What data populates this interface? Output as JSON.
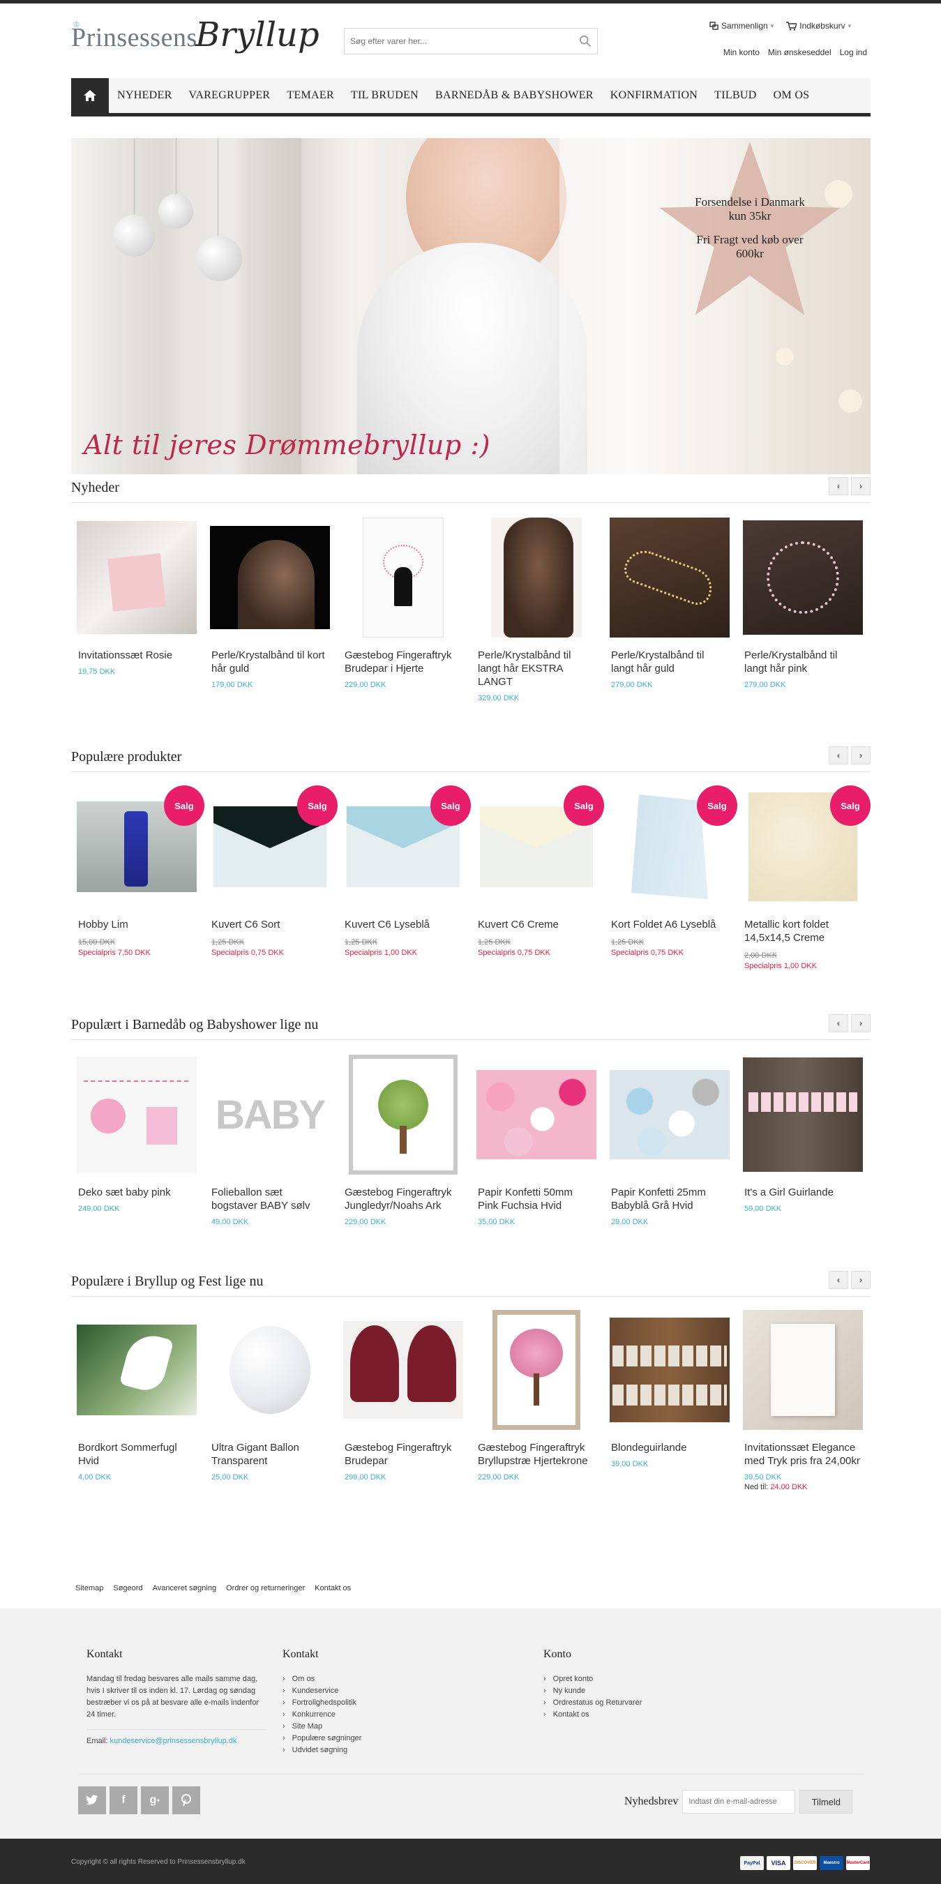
{
  "header": {
    "logo_part1": "Prinsessens",
    "logo_part2": "Bryllup",
    "search_placeholder": "Søg efter varer her...",
    "compare_label": "Sammenlign",
    "cart_label": "Indkøbskurv",
    "account_links": [
      "Min konto",
      "Min ønskeseddel",
      "Log ind"
    ]
  },
  "nav": {
    "items": [
      "NYHEDER",
      "VAREGRUPPER",
      "TEMAER",
      "TIL BRUDEN",
      "BARNEDÅB & BABYSHOWER",
      "KONFIRMATION",
      "TILBUD",
      "OM OS"
    ]
  },
  "hero": {
    "star_line1": "Forsendelse i Danmark kun 35kr",
    "star_line2": "Fri Fragt ved køb over 600kr",
    "script_text": "Alt til jeres Drømmebryllup :)"
  },
  "sections": [
    {
      "title": "Nyheder",
      "products": [
        {
          "name": "Invitationssæt Rosie",
          "price": "19,75 DKK"
        },
        {
          "name": "Perle/Krystalbånd til kort hår guld",
          "price": "179,00 DKK"
        },
        {
          "name": "Gæstebog Fingeraftryk Brudepar i Hjerte",
          "price": "229,00 DKK"
        },
        {
          "name": "Perle/Krystalbånd til langt hår EKSTRA LANGT",
          "price": "329,00 DKK"
        },
        {
          "name": "Perle/Krystalbånd til langt hår guld",
          "price": "279,00 DKK"
        },
        {
          "name": "Perle/Krystalbånd til langt hår pink",
          "price": "279,00 DKK"
        }
      ]
    },
    {
      "title": "Populære produkter",
      "sale_label": "Salg",
      "products": [
        {
          "name": "Hobby Lim",
          "old_price": "15,00 DKK",
          "special": "Specialpris 7,50 DKK"
        },
        {
          "name": "Kuvert C6 Sort",
          "old_price": "1,25 DKK",
          "special": "Specialpris 0,75 DKK"
        },
        {
          "name": "Kuvert C6 Lyseblå",
          "old_price": "1,25 DKK",
          "special": "Specialpris 1,00 DKK"
        },
        {
          "name": "Kuvert C6 Creme",
          "old_price": "1,25 DKK",
          "special": "Specialpris 0,75 DKK"
        },
        {
          "name": "Kort Foldet A6 Lyseblå",
          "old_price": "1,25 DKK",
          "special": "Specialpris 0,75 DKK"
        },
        {
          "name": "Metallic kort foldet 14,5x14,5 Creme",
          "old_price": "2,00 DKK",
          "special": "Specialpris 1,00 DKK"
        }
      ]
    },
    {
      "title": "Populært i Barnedåb og Babyshower lige nu",
      "products": [
        {
          "name": "Deko sæt baby pink",
          "price": "249,00 DKK"
        },
        {
          "name": "Folieballon sæt bogstaver BABY sølv",
          "price": "49,00 DKK"
        },
        {
          "name": "Gæstebog Fingeraftryk Jungledyr/Noahs Ark",
          "price": "229,00 DKK"
        },
        {
          "name": "Papir Konfetti 50mm Pink Fuchsia Hvid",
          "price": "35,00 DKK"
        },
        {
          "name": "Papir Konfetti 25mm Babyblå Grå Hvid",
          "price": "29,00 DKK"
        },
        {
          "name": "It's a Girl Guirlande",
          "price": "59,00 DKK"
        }
      ]
    },
    {
      "title": "Populære i Bryllup og Fest lige nu",
      "products": [
        {
          "name": "Bordkort Sommerfugl Hvid",
          "price": "4,00 DKK"
        },
        {
          "name": "Ultra Gigant Ballon Transparent",
          "price": "25,00 DKK"
        },
        {
          "name": "Gæstebog Fingeraftryk Brudepar",
          "price": "299,00 DKK"
        },
        {
          "name": "Gæstebog Fingeraftryk Bryllupstræ Hjertekrone",
          "price": "229,00 DKK"
        },
        {
          "name": "Blondeguirlande",
          "price": "39,00 DKK"
        },
        {
          "name": "Invitationssæt Elegance med Tryk pris fra 24,00kr",
          "price": "39,50 DKK",
          "ned_til_label": "Ned til:",
          "ned_til_price": "24,00 DKK"
        }
      ]
    }
  ],
  "footer": {
    "links": [
      "Sitemap",
      "Søgeord",
      "Avanceret søgning",
      "Ordrer og returneringer",
      "Kontakt os"
    ],
    "contact_title": "Kontakt",
    "contact_text": "Mandag til fredag besvares alle mails samme dag, hvis I skriver til os inden kl. 17. Lørdag og søndag bestræber vi os på at besvare alle e-mails indenfor 24 timer.",
    "email_label": "Email:",
    "email": "kundeservice@prinsessensbryllup.dk",
    "col2_title": "Kontakt",
    "col2_links": [
      "Om os",
      "Kundeservice",
      "Fortrolighedspolitik",
      "Konkurrence",
      "Site Map",
      "Populære søgninger",
      "Udvidet søgning"
    ],
    "col3_title": "Konto",
    "col3_links": [
      "Opret konto",
      "Ny kunde",
      "Ordrestatus og Returvarer",
      "Kontakt os"
    ],
    "social": [
      "twitter-icon",
      "facebook-icon",
      "google-plus-icon",
      "pinterest-icon"
    ],
    "newsletter_label": "Nyhedsbrev",
    "newsletter_placeholder": "Indtast din e-mail-adresse",
    "newsletter_button": "Tilmeld",
    "copyright": "Copyright © all rights Reserved to Prinsessensbryllup.dk",
    "payments": [
      "PayPal",
      "VISA",
      "DISCOVER",
      "Maestro",
      "MasterCard"
    ]
  },
  "colors": {
    "accent_price": "#3bb0d6",
    "sale_badge": "#e91e6a",
    "special_price": "#e8213f",
    "dark": "#2b2b2b"
  }
}
